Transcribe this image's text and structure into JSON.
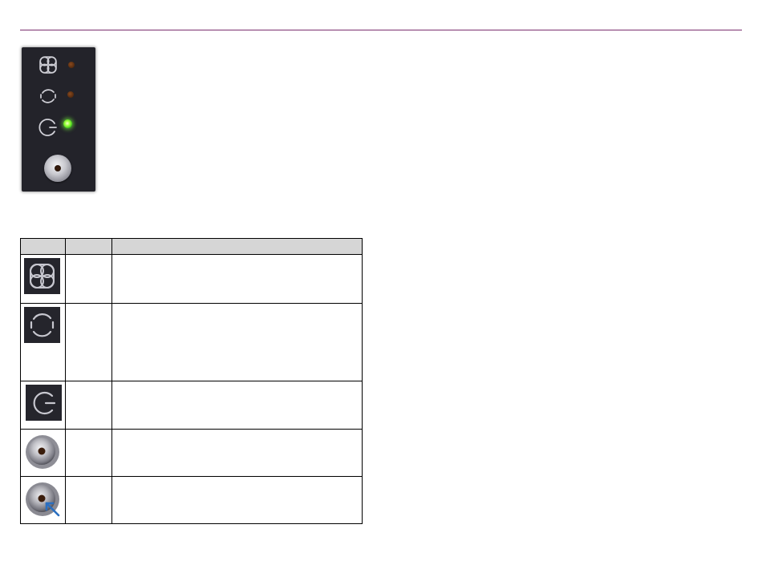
{
  "panel": {
    "background": "#23232a",
    "indicators": [
      {
        "icon": "fan-icon",
        "led": "off"
      },
      {
        "icon": "cycle-icon",
        "led": "off"
      },
      {
        "icon": "power-cycle-icon",
        "led": "on"
      }
    ],
    "led_on_color": "#3fe02a",
    "led_off_color": "#5a2c0f",
    "button": {
      "icon": "recessed-button-icon"
    }
  },
  "table": {
    "header": [
      "",
      "",
      ""
    ],
    "rows": [
      {
        "icon": "fan-icon",
        "col2": "",
        "col3": ""
      },
      {
        "icon": "cycle-icon",
        "col2": "",
        "col3": ""
      },
      {
        "icon": "power-cycle-icon",
        "col2": "",
        "col3": ""
      },
      {
        "icon": "recessed-button-icon",
        "col2": "",
        "col3": ""
      },
      {
        "icon": "recessed-button-pressed-icon",
        "col2": "",
        "col3": ""
      }
    ]
  },
  "colors": {
    "accent_rule": "#7a2e6e",
    "arrow": "#2a6fc0"
  }
}
